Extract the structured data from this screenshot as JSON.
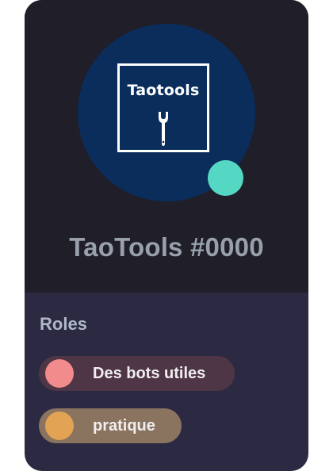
{
  "profile": {
    "logo_text": "Taotools",
    "logo_icon": "wrench-icon",
    "username": "TaoTools #0000",
    "status_color": "#55d8c3"
  },
  "roles": {
    "title": "Roles",
    "items": [
      {
        "label": "Des bots utiles",
        "dot_color": "#f28b8b",
        "pill_color": "#4f3646"
      },
      {
        "label": "pratique",
        "dot_color": "#e3a354",
        "pill_color": "#8a7460"
      }
    ]
  },
  "colors": {
    "card_top": "#1f1e29",
    "card_bottom": "#2c2a43",
    "avatar_bg": "#0b2d5c"
  }
}
